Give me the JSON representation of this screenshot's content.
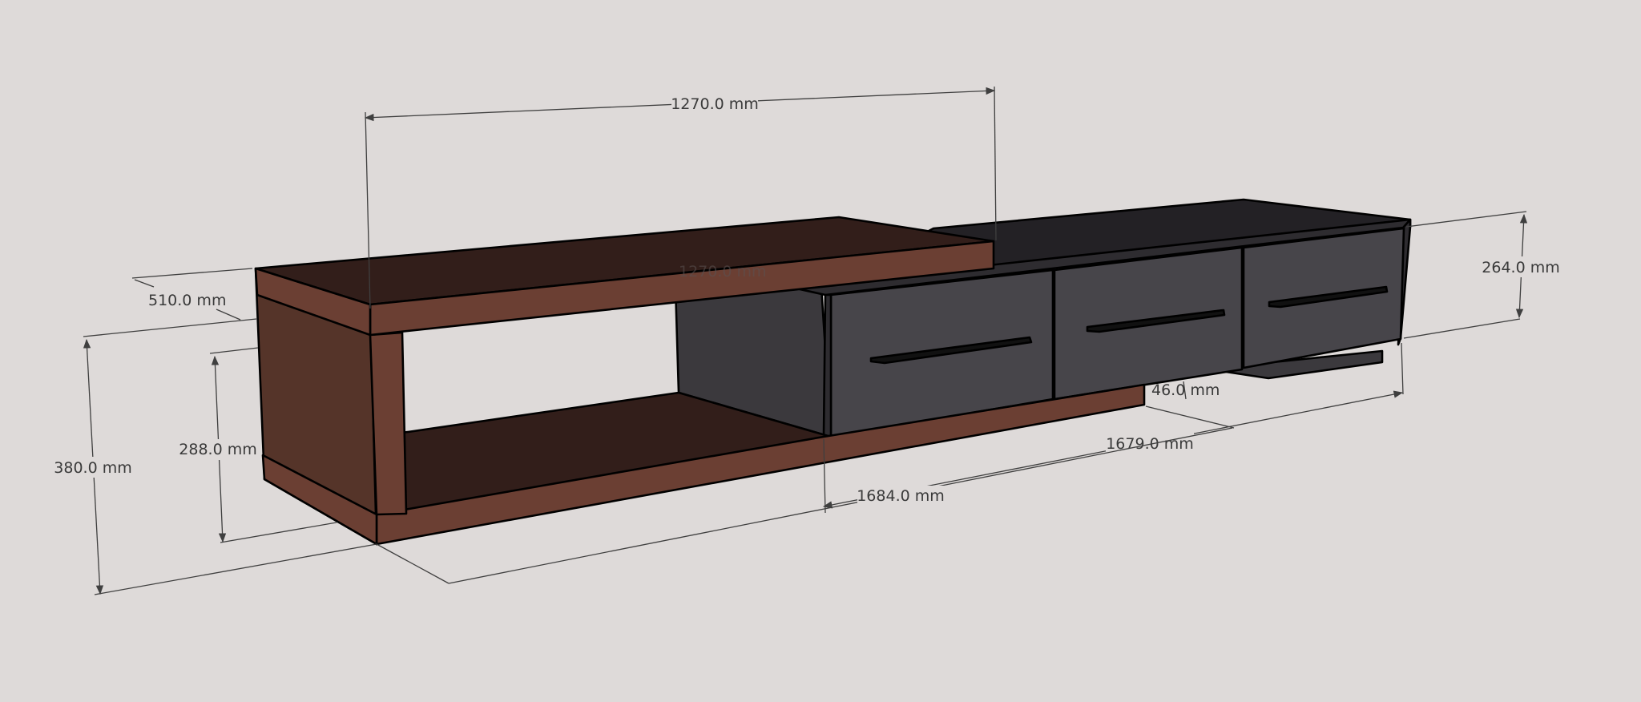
{
  "dimensions": {
    "top_width": "1270.0 mm",
    "top_width_hidden": "1270.0 mm",
    "depth": "510.0 mm",
    "total_height": "380.0 mm",
    "inner_height": "288.0 mm",
    "drawer_height": "264.0 mm",
    "plinth_height": "46.0 mm",
    "extended_length": "1679.0 mm",
    "base_length": "1684.0 mm"
  },
  "colors": {
    "background": "#dedad9",
    "walnut_front": "#6b3f33",
    "walnut_side": "#553429",
    "walnut_top": "#321e1a",
    "drawer_front": "#47454a",
    "cabinet_side": "#3b393d",
    "cabinet_top": "#232125",
    "handle": "#111111"
  },
  "drawers": [
    {
      "handle": "bar-handle"
    },
    {
      "handle": "bar-handle"
    },
    {
      "handle": "bar-handle"
    }
  ]
}
